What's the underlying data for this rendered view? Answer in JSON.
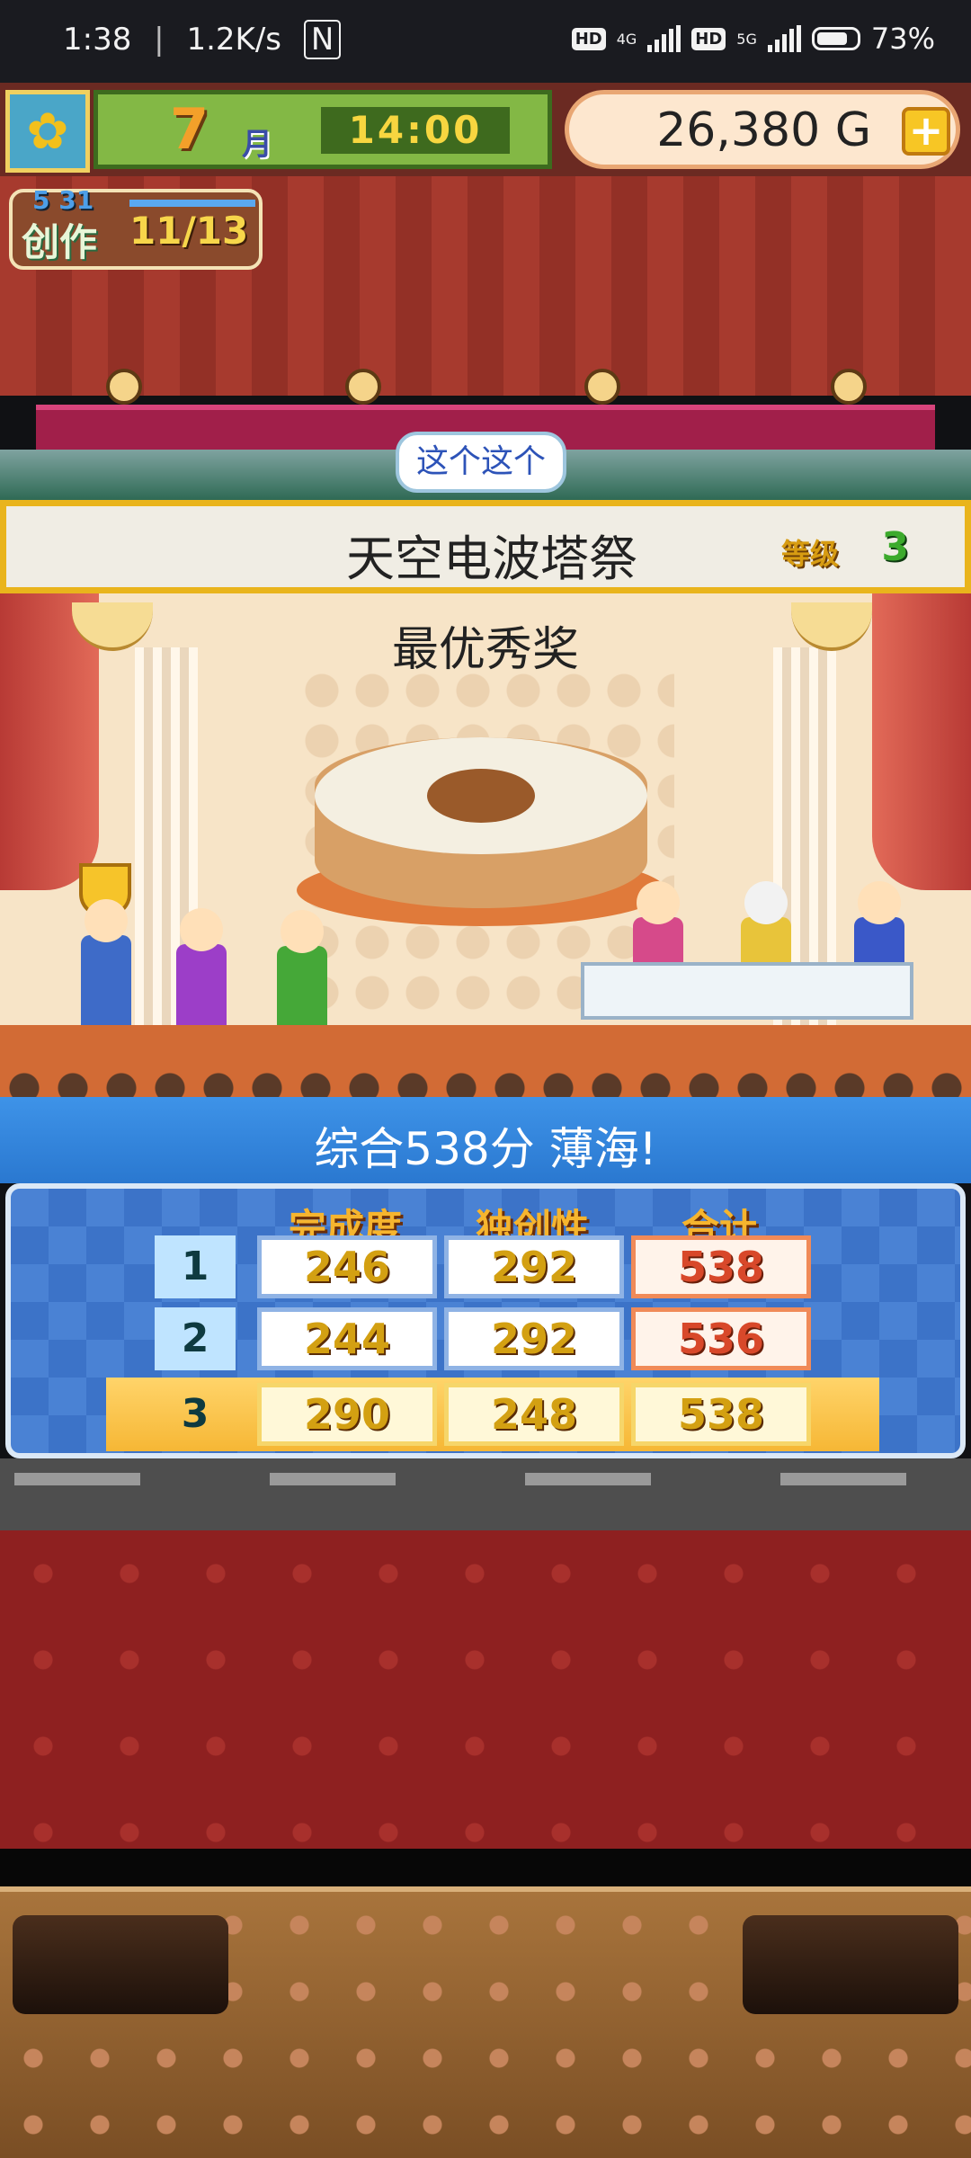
{
  "status_bar": {
    "time": "1:38",
    "speed": "1.2K/s",
    "nfc": "N",
    "hd1": "HD",
    "net1": "4G",
    "hd2": "HD",
    "net2": "5G",
    "battery": "73%"
  },
  "hud": {
    "month_number": "7",
    "month_label": "月",
    "clock": "14:00",
    "money_amount": "26,380",
    "money_unit": "G",
    "add_money_label": "+"
  },
  "project_badge": {
    "date": "5 31",
    "label": "创作",
    "progress": "11/13"
  },
  "speech_bubble": "这个这个",
  "event": {
    "title": "天空电波塔祭",
    "rank_label": "等级",
    "rank_value": "3"
  },
  "award": {
    "name": "最优秀奖"
  },
  "score": {
    "summary": "综合538分 薄海!",
    "headers": [
      "完成度",
      "独创性",
      "合计"
    ],
    "rows": [
      {
        "rank": "1",
        "completion": "246",
        "originality": "292",
        "total": "538"
      },
      {
        "rank": "2",
        "completion": "244",
        "originality": "292",
        "total": "536"
      },
      {
        "rank": "3",
        "completion": "290",
        "originality": "248",
        "total": "538"
      }
    ]
  },
  "colors": {
    "accent_gold": "#e9b41c",
    "score_blue": "#2a78d0",
    "total_orange": "#f08a58"
  },
  "icons": {
    "portrait": "sunflower-icon"
  }
}
